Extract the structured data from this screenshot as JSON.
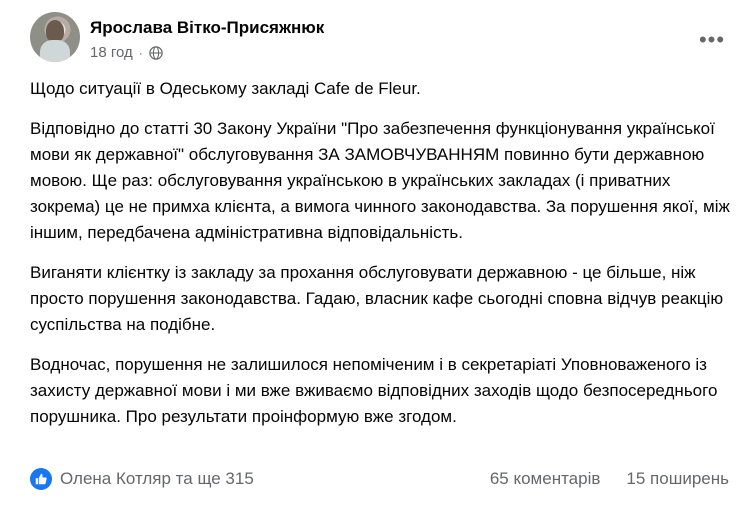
{
  "post": {
    "author": "Ярослава Вітко-Присяжнюк",
    "time": "18 год",
    "paragraphs": [
      "Щодо ситуації в Одеському закладі Cafe de Fleur.",
      "Відповідно до статті 30 Закону України \"Про забезпечення функціонування української мови як державної\" обслуговування ЗА ЗАМОВЧУВАННЯМ повинно бути державною мовою.  Ще раз: обслуговування українською в українських закладах (і приватних зокрема) це не примха клієнта, а вимога чинного законодавства. За порушення якої, між іншим, передбачена адміністративна відповідальність.",
      "Виганяти клієнтку із закладу за прохання обслуговувати державною - це більше, ніж просто порушення законодавства. Гадаю, власник кафе сьогодні сповна відчув реакцію суспільства на подібне.",
      "Водночас, порушення не залишилося непоміченим і в секретаріаті Уповноваженого із захисту державної мови і ми вже вживаємо відповідних заходів щодо безпосереднього порушника. Про результати проінформую вже згодом."
    ],
    "reactions": "Олена Котляр та ще 315",
    "comments": "65 коментарів",
    "shares": "15 поширень"
  },
  "icons": {
    "privacy": "globe-icon",
    "menu": "more-options-icon",
    "reaction": "like-icon"
  },
  "colors": {
    "accent": "#1877f2",
    "secondary_text": "#65676b",
    "primary_text": "#050505"
  }
}
